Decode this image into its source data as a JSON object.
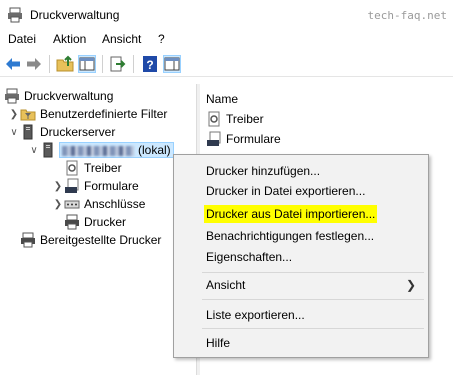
{
  "window": {
    "title": "Druckverwaltung",
    "watermark": "tech-faq.net"
  },
  "menubar": {
    "items": [
      "Datei",
      "Aktion",
      "Ansicht",
      "?"
    ]
  },
  "toolbar": {
    "buttons": [
      "back-icon",
      "forward-icon",
      "folder-up-icon",
      "show-tree-icon",
      "export-list-icon",
      "help-icon",
      "properties-pane-icon"
    ]
  },
  "tree": {
    "root": "Druckverwaltung",
    "filters": "Benutzerdefinierte Filter",
    "servers": "Druckerserver",
    "local_server_suffix": "(lokal)",
    "children": [
      "Treiber",
      "Formulare",
      "Anschlüsse",
      "Drucker"
    ],
    "deployed": "Bereitgestellte Drucker"
  },
  "list": {
    "header": "Name",
    "rows": [
      "Treiber",
      "Formulare"
    ]
  },
  "context_menu": {
    "items": [
      "Drucker hinzufügen...",
      "Drucker in Datei exportieren...",
      "Drucker aus Datei importieren...",
      "Benachrichtigungen festlegen...",
      "Eigenschaften...",
      "Ansicht",
      "Liste exportieren...",
      "Hilfe"
    ],
    "highlight_color": "#ffff00"
  }
}
